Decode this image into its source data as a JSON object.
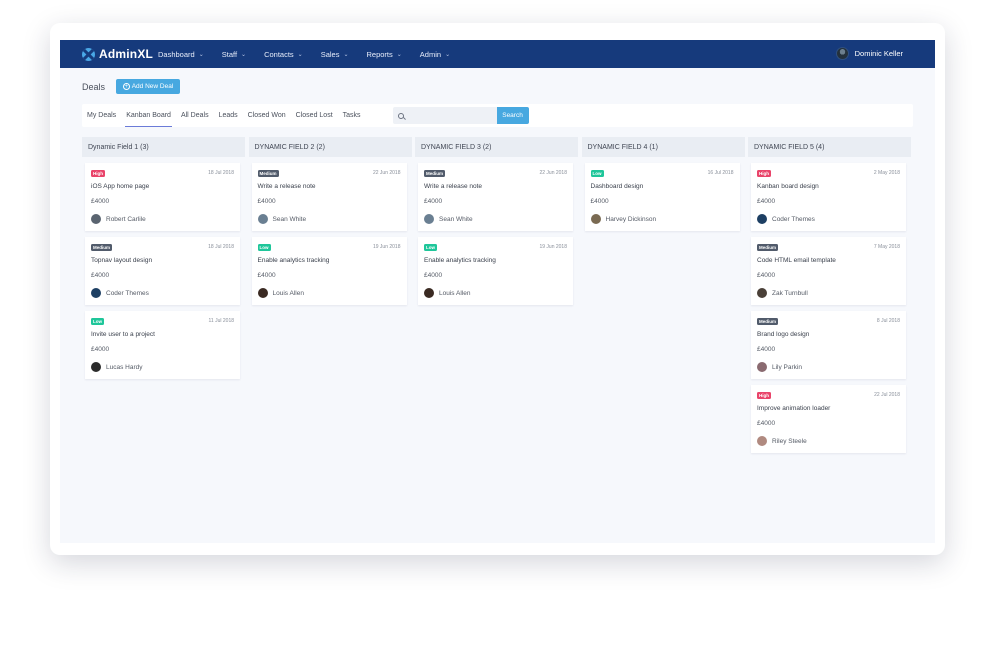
{
  "app": {
    "brand": "AdminXL",
    "user_name": "Dominic Keller",
    "accent": "#47a8e0",
    "nav_color": "#163a7c"
  },
  "nav": [
    {
      "label": "Dashboard",
      "name": "dashboard"
    },
    {
      "label": "Staff",
      "name": "staff"
    },
    {
      "label": "Contacts",
      "name": "contacts"
    },
    {
      "label": "Sales",
      "name": "sales"
    },
    {
      "label": "Reports",
      "name": "reports"
    },
    {
      "label": "Admin",
      "name": "admin"
    }
  ],
  "page": {
    "title": "Deals",
    "add_button": "Add New Deal"
  },
  "tabs": [
    {
      "label": "My Deals",
      "active": false
    },
    {
      "label": "Kanban Board",
      "active": true
    },
    {
      "label": "All Deals",
      "active": false
    },
    {
      "label": "Leads",
      "active": false
    },
    {
      "label": "Closed Won",
      "active": false
    },
    {
      "label": "Closed Lost",
      "active": false
    },
    {
      "label": "Tasks",
      "active": false
    }
  ],
  "search": {
    "placeholder": "",
    "value": "",
    "button": "Search"
  },
  "columns": [
    {
      "title": "Dynamic Field 1 (3)",
      "cards": [
        {
          "priority": "High",
          "level": "high",
          "date": "18 Jul 2018",
          "title": "iOS App home page",
          "amount": "£4000",
          "user": "Robert Carlile",
          "avatar_color": "#5a6470"
        },
        {
          "priority": "Medium",
          "level": "medium",
          "date": "18 Jul 2018",
          "title": "Topnav layout design",
          "amount": "£4000",
          "user": "Coder Themes",
          "avatar_color": "#1d3f63"
        },
        {
          "priority": "Low",
          "level": "low",
          "date": "11 Jul 2018",
          "title": "Invite user to a project",
          "amount": "£4000",
          "user": "Lucas Hardy",
          "avatar_color": "#2b2b2b"
        }
      ]
    },
    {
      "title": "DYNAMIC FIELD 2 (2)",
      "cards": [
        {
          "priority": "Medium",
          "level": "medium",
          "date": "22 Jun 2018",
          "title": "Write a release note",
          "amount": "£4000",
          "user": "Sean White",
          "avatar_color": "#6a7f92"
        },
        {
          "priority": "Low",
          "level": "low",
          "date": "19 Jun 2018",
          "title": "Enable analytics tracking",
          "amount": "£4000",
          "user": "Louis Allen",
          "avatar_color": "#3a2a22"
        }
      ]
    },
    {
      "title": "DYNAMIC FIELD 3 (2)",
      "cards": [
        {
          "priority": "Medium",
          "level": "medium",
          "date": "22 Jun 2018",
          "title": "Write a release note",
          "amount": "£4000",
          "user": "Sean White",
          "avatar_color": "#6a7f92"
        },
        {
          "priority": "Low",
          "level": "low",
          "date": "19 Jun 2018",
          "title": "Enable analytics tracking",
          "amount": "£4000",
          "user": "Louis Allen",
          "avatar_color": "#3a2a22"
        }
      ]
    },
    {
      "title": "DYNAMIC FIELD 4 (1)",
      "cards": [
        {
          "priority": "Low",
          "level": "low",
          "date": "16 Jul 2018",
          "title": "Dashboard design",
          "amount": "£4000",
          "user": "Harvey Dickinson",
          "avatar_color": "#7a6a52"
        }
      ]
    },
    {
      "title": "DYNAMIC FIELD 5 (4)",
      "cards": [
        {
          "priority": "High",
          "level": "high",
          "date": "2 May 2018",
          "title": "Kanban board design",
          "amount": "£4000",
          "user": "Coder Themes",
          "avatar_color": "#1d3f63"
        },
        {
          "priority": "Medium",
          "level": "medium",
          "date": "7 May 2018",
          "title": "Code HTML email template",
          "amount": "£4000",
          "user": "Zak Turnbull",
          "avatar_color": "#4a4038"
        },
        {
          "priority": "Medium",
          "level": "medium",
          "date": "8 Jul 2018",
          "title": "Brand logo design",
          "amount": "£4000",
          "user": "Lily Parkin",
          "avatar_color": "#8a6a70"
        },
        {
          "priority": "High",
          "level": "high",
          "date": "22 Jul 2018",
          "title": "Improve animation loader",
          "amount": "£4000",
          "user": "Riley Steele",
          "avatar_color": "#b08a80"
        }
      ]
    }
  ]
}
